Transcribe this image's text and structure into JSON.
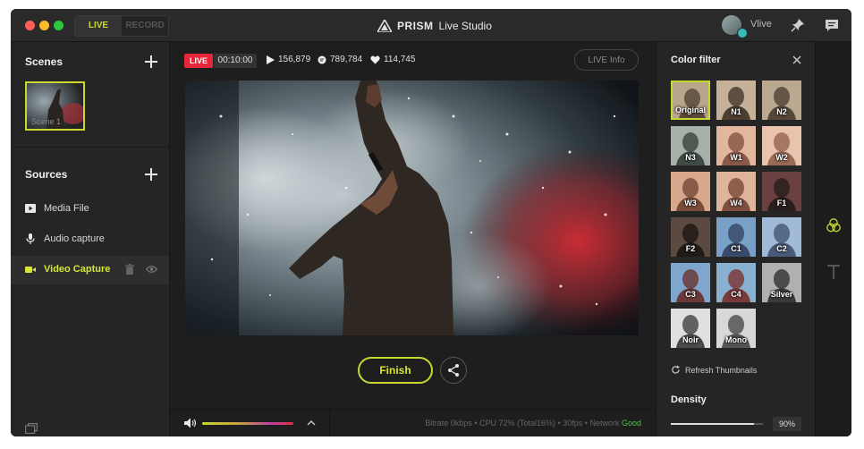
{
  "titlebar": {
    "mode_live": "LIVE",
    "mode_record": "RECORD",
    "brand": "PRISM",
    "product": "Live Studio",
    "username": "Vlive"
  },
  "scenes": {
    "title": "Scenes",
    "items": [
      {
        "label": "Scene 1"
      }
    ]
  },
  "sources": {
    "title": "Sources",
    "items": [
      {
        "label": "Media File",
        "icon": "media-file-icon"
      },
      {
        "label": "Audio capture",
        "icon": "microphone-icon"
      },
      {
        "label": "Video Capture",
        "icon": "video-camera-icon",
        "active": true
      }
    ]
  },
  "broadcast": {
    "live_badge": "LIVE",
    "timer": "00:10:00",
    "views": "156,879",
    "comments": "789,784",
    "likes": "114,745",
    "live_info": "LIVE Info",
    "finish": "Finish"
  },
  "statusbar": {
    "bitrate": "Bitrate 0kbps",
    "cpu": "CPU 72% (Total16%)",
    "fps": "30fps",
    "network_label": "Network",
    "network_status": "Good",
    "separator": "•"
  },
  "color_filter": {
    "title": "Color filter",
    "filters": [
      "Original",
      "N1",
      "N2",
      "N3",
      "W1",
      "W2",
      "W3",
      "W4",
      "F1",
      "F2",
      "C1",
      "C2",
      "C3",
      "C4",
      "Silver",
      "Noir",
      "Mono"
    ],
    "selected": "Original",
    "refresh": "Refresh Thumbnails",
    "density_title": "Density",
    "density_value": "90%",
    "density_fraction": 0.9
  },
  "colors": {
    "accent": "#c8d830",
    "live_red": "#e8263a",
    "network_good": "#4fc24a"
  }
}
